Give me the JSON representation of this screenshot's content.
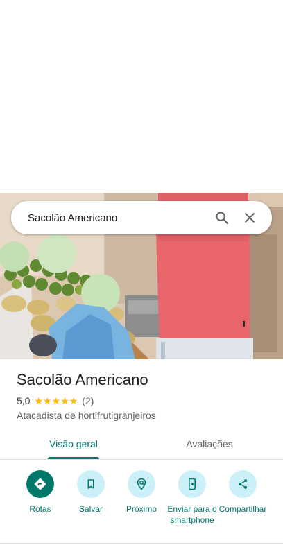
{
  "search": {
    "value": "Sacolão Americano",
    "search_icon": "search-icon",
    "close_icon": "close-icon"
  },
  "place": {
    "name": "Sacolão Americano",
    "rating": "5,0",
    "stars": 5,
    "review_count": "(2)",
    "category": "Atacadista de hortifrutigranjeiros"
  },
  "tabs": [
    {
      "label": "Visão geral",
      "active": true
    },
    {
      "label": "Avaliações",
      "active": false
    }
  ],
  "actions": [
    {
      "label": "Rotas",
      "icon": "directions-icon"
    },
    {
      "label": "Salvar",
      "icon": "bookmark-icon"
    },
    {
      "label": "Próximo",
      "icon": "nearby-icon"
    },
    {
      "label": "Enviar para o smartphone",
      "icon": "send-to-phone-icon"
    },
    {
      "label": "Compartilhar",
      "icon": "share-icon"
    }
  ],
  "colors": {
    "accent": "#00796b",
    "action_bg": "#cbf0f8",
    "star": "#fbbc04"
  }
}
